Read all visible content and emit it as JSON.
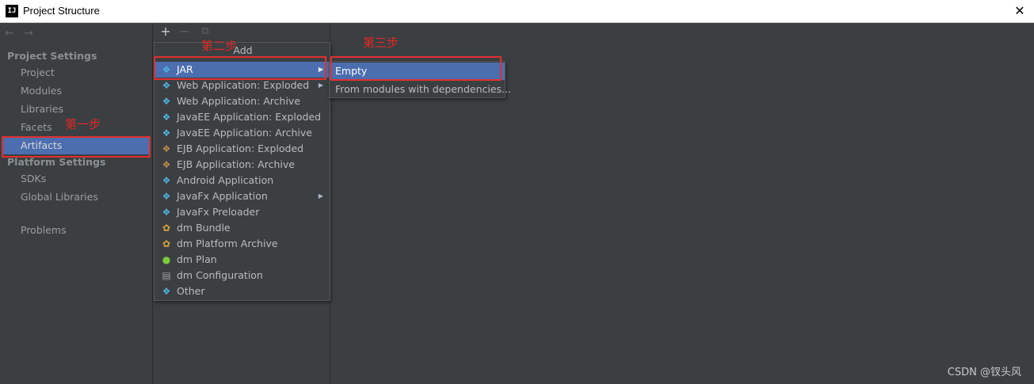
{
  "window": {
    "title": "Project Structure",
    "icon_label": "IJ",
    "close_symbol": "✕"
  },
  "sidebar": {
    "nav_arrows": "← →",
    "project_settings_header": "Project Settings",
    "project_items": [
      {
        "label": "Project"
      },
      {
        "label": "Modules"
      },
      {
        "label": "Libraries"
      },
      {
        "label": "Facets"
      },
      {
        "label": "Artifacts",
        "selected": true
      }
    ],
    "platform_settings_header": "Platform Settings",
    "platform_items": [
      {
        "label": "SDKs"
      },
      {
        "label": "Global Libraries"
      }
    ],
    "problems_label": "Problems"
  },
  "toolbar": {
    "add_symbol": "+",
    "remove_symbol": "−",
    "copy_symbol": "⧉"
  },
  "add_popup": {
    "title": "Add",
    "items": [
      {
        "label": "JAR",
        "icon": "artifact-diamond-icon",
        "has_submenu": true,
        "highlighted": true
      },
      {
        "label": "Web Application: Exploded",
        "icon": "web-app-icon",
        "has_submenu": true
      },
      {
        "label": "Web Application: Archive",
        "icon": "web-app-icon"
      },
      {
        "label": "JavaEE Application: Exploded",
        "icon": "javaee-icon"
      },
      {
        "label": "JavaEE Application: Archive",
        "icon": "javaee-icon"
      },
      {
        "label": "EJB Application: Exploded",
        "icon": "ejb-icon"
      },
      {
        "label": "EJB Application: Archive",
        "icon": "ejb-icon"
      },
      {
        "label": "Android Application",
        "icon": "artifact-diamond-icon"
      },
      {
        "label": "JavaFx Application",
        "icon": "artifact-diamond-icon",
        "has_submenu": true
      },
      {
        "label": "JavaFx Preloader",
        "icon": "artifact-diamond-icon"
      },
      {
        "label": "dm Bundle",
        "icon": "dm-bundle-icon"
      },
      {
        "label": "dm Platform Archive",
        "icon": "dm-platform-icon"
      },
      {
        "label": "dm Plan",
        "icon": "dm-plan-icon"
      },
      {
        "label": "dm Configuration",
        "icon": "dm-config-icon"
      },
      {
        "label": "Other",
        "icon": "artifact-diamond-icon"
      }
    ]
  },
  "jar_submenu": {
    "items": [
      {
        "label": "Empty",
        "highlighted": true
      },
      {
        "label": "From modules with dependencies..."
      }
    ]
  },
  "annotations": {
    "step1": "第一步",
    "step2": "第二步",
    "step3": "第三步",
    "color": "#e03030"
  },
  "watermark": "CSDN @钗头风",
  "colors": {
    "background": "#3c3f41",
    "selection": "#4b6eaf",
    "text": "#bbbbbb"
  }
}
